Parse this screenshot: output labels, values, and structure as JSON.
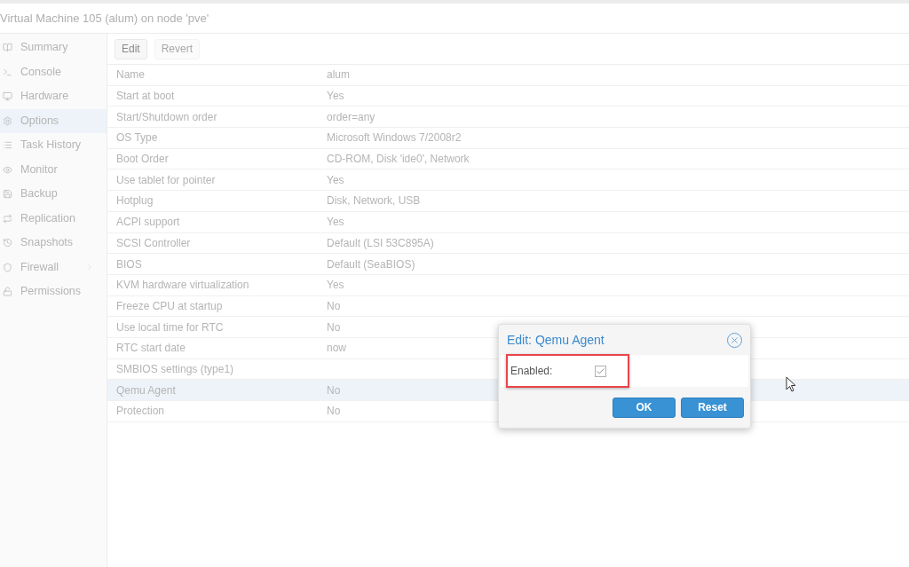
{
  "title": "Virtual Machine 105 (alum) on node 'pve'",
  "sidebar": {
    "items": [
      {
        "label": "Summary",
        "kind": "summary",
        "selected": false
      },
      {
        "label": "Console",
        "kind": "console",
        "selected": false
      },
      {
        "label": "Hardware",
        "kind": "hardware",
        "selected": false
      },
      {
        "label": "Options",
        "kind": "options",
        "selected": true
      },
      {
        "label": "Task History",
        "kind": "history",
        "selected": false
      },
      {
        "label": "Monitor",
        "kind": "monitor",
        "selected": false
      },
      {
        "label": "Backup",
        "kind": "backup",
        "selected": false
      },
      {
        "label": "Replication",
        "kind": "replication",
        "selected": false
      },
      {
        "label": "Snapshots",
        "kind": "snapshots",
        "selected": false
      },
      {
        "label": "Firewall",
        "kind": "firewall",
        "selected": false,
        "expandable": true
      },
      {
        "label": "Permissions",
        "kind": "permissions",
        "selected": false
      }
    ]
  },
  "toolbar": {
    "buttons": [
      {
        "label": "Edit",
        "disabled": false
      },
      {
        "label": "Revert",
        "disabled": true
      }
    ]
  },
  "table": {
    "rows": [
      {
        "name": "Name",
        "value": "alum",
        "selected": false
      },
      {
        "name": "Start at boot",
        "value": "Yes",
        "selected": false
      },
      {
        "name": "Start/Shutdown order",
        "value": "order=any",
        "selected": false
      },
      {
        "name": "OS Type",
        "value": "Microsoft Windows 7/2008r2",
        "selected": false
      },
      {
        "name": "Boot Order",
        "value": "CD-ROM, Disk 'ide0', Network",
        "selected": false
      },
      {
        "name": "Use tablet for pointer",
        "value": "Yes",
        "selected": false
      },
      {
        "name": "Hotplug",
        "value": "Disk, Network, USB",
        "selected": false
      },
      {
        "name": "ACPI support",
        "value": "Yes",
        "selected": false
      },
      {
        "name": "SCSI Controller",
        "value": "Default (LSI 53C895A)",
        "selected": false
      },
      {
        "name": "BIOS",
        "value": "Default (SeaBIOS)",
        "selected": false
      },
      {
        "name": "KVM hardware virtualization",
        "value": "Yes",
        "selected": false
      },
      {
        "name": "Freeze CPU at startup",
        "value": "No",
        "selected": false
      },
      {
        "name": "Use local time for RTC",
        "value": "No",
        "selected": false
      },
      {
        "name": "RTC start date",
        "value": "now",
        "selected": false
      },
      {
        "name": "SMBIOS settings (type1)",
        "selected": false
      },
      {
        "name": "Qemu Agent",
        "value": "No",
        "selected": true
      },
      {
        "name": "Protection",
        "value": "No",
        "selected": false
      }
    ]
  },
  "dialog": {
    "title": "Edit: Qemu Agent",
    "field": {
      "label": "Enabled:",
      "checked": true
    },
    "buttons": [
      "OK",
      "Reset"
    ]
  }
}
